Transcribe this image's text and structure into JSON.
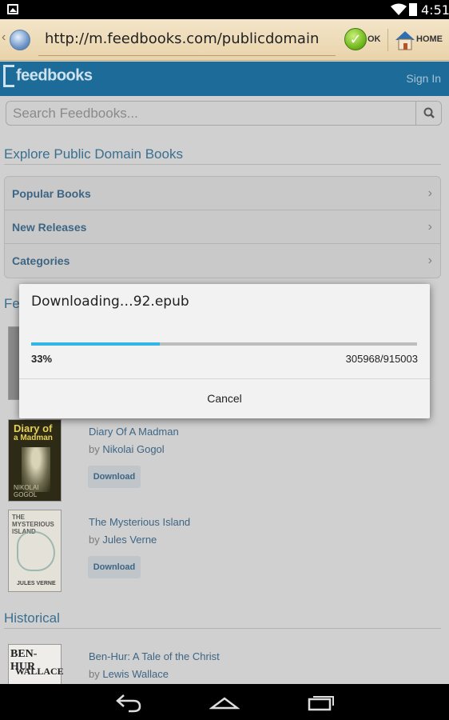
{
  "status_bar": {
    "time": "4:51"
  },
  "browser": {
    "url": "http://m.feedbooks.com/publicdomain",
    "ok_label": "OK",
    "home_label": "HOME"
  },
  "header": {
    "logo": "feedbooks",
    "sign_in": "Sign In"
  },
  "search": {
    "placeholder": "Search Feedbooks..."
  },
  "sections": {
    "explore_title": "Explore Public Domain Books",
    "featured_title_partial": "Fe",
    "historical_title": "Historical"
  },
  "nav_items": [
    {
      "label": "Popular Books"
    },
    {
      "label": "New Releases"
    },
    {
      "label": "Categories"
    }
  ],
  "books": [
    {
      "title": "Diary Of A Madman",
      "by": "by",
      "author": "Nikolai Gogol",
      "button": "Download",
      "cover_lines": [
        "Diary of",
        "a Madman",
        "NIKOLAI GOGOL"
      ]
    },
    {
      "title": "The Mysterious Island",
      "by": "by",
      "author": "Jules Verne",
      "button": "Download",
      "cover_lines": [
        "THE MYSTERIOUS ISLAND",
        "JULES VERNE"
      ]
    },
    {
      "title": "Ben-Hur: A Tale of the Christ",
      "by": "by",
      "author": "Lewis Wallace",
      "cover_lines": [
        "BEN-HUR",
        "WALLACE"
      ]
    }
  ],
  "dialog": {
    "title": "Downloading…92.epub",
    "progress_percent_label": "33%",
    "progress_fraction": 0.334,
    "count": "305968/915003",
    "cancel_label": "Cancel"
  },
  "colors": {
    "header": "#1d6b98",
    "progress": "#33b5e5",
    "link": "#3d6584"
  }
}
